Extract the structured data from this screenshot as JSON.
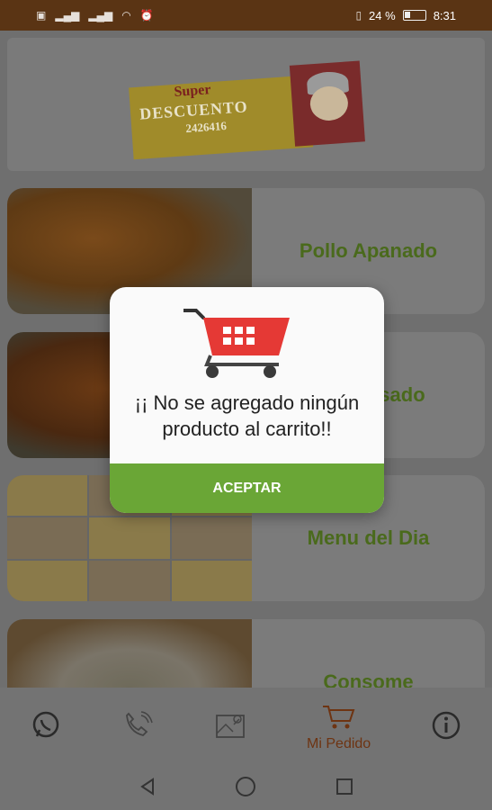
{
  "status_bar": {
    "battery": "24 %",
    "time": "8:31",
    "left_icons": [
      "whatsapp-business-icon",
      "signal-icon",
      "signal-icon",
      "wifi-icon",
      "alarm-icon"
    ],
    "right_icons": [
      "vibrate-icon",
      "battery-icon"
    ]
  },
  "banner": {
    "title": "Super",
    "subtitle": "DESCUENTO",
    "number": "2426416"
  },
  "menu": [
    {
      "label": "Pollo Apanado",
      "icon": "fried-chicken-photo"
    },
    {
      "label": "Pollo Asado",
      "icon": "roast-chicken-photo"
    },
    {
      "label": "Menu del Dia",
      "icon": "menu-collage-photo"
    },
    {
      "label": "Consome",
      "icon": "soup-photo"
    }
  ],
  "dialog": {
    "line1": "¡¡ No se agregado ningún",
    "line2": "producto al carrito!!",
    "button": "ACEPTAR",
    "icon": "shopping-cart-icon"
  },
  "bottom_nav": {
    "whatsapp": "whatsapp-icon",
    "call": "phone-icon",
    "map": "map-icon",
    "order_label": "Mi Pedido",
    "info": "info-icon"
  },
  "colors": {
    "status_bar": "#5a3414",
    "accent_green": "#6aa636",
    "menu_text_green": "#4a6a1c",
    "active_nav": "#6e3412"
  }
}
